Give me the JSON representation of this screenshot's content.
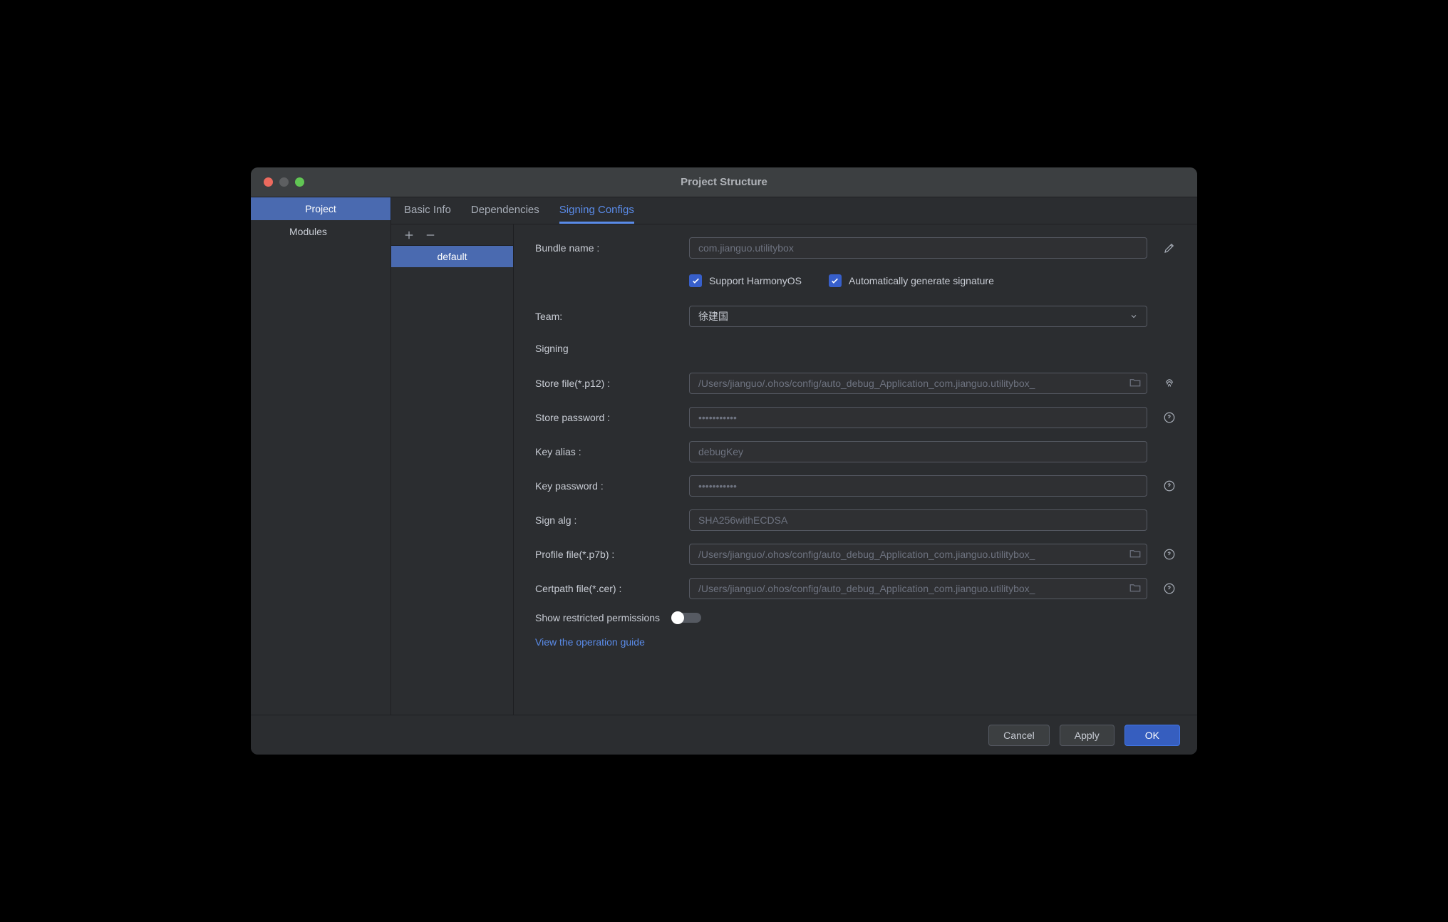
{
  "window": {
    "title": "Project Structure"
  },
  "sidebar": {
    "items": [
      {
        "label": "Project",
        "selected": true
      },
      {
        "label": "Modules",
        "selected": false
      }
    ]
  },
  "tabs": [
    {
      "label": "Basic Info",
      "active": false
    },
    {
      "label": "Dependencies",
      "active": false
    },
    {
      "label": "Signing Configs",
      "active": true
    }
  ],
  "configList": {
    "items": [
      {
        "label": "default",
        "selected": true
      }
    ]
  },
  "form": {
    "bundle_name_label": "Bundle name :",
    "bundle_name_value": "com.jianguo.utilitybox",
    "support_harmony_label": "Support HarmonyOS",
    "autogen_label": "Automatically generate signature",
    "team_label": "Team:",
    "team_value": "徐建国",
    "signing_section": "Signing",
    "store_file_label": "Store file(*.p12) :",
    "store_file_value": "/Users/jianguo/.ohos/config/auto_debug_Application_com.jianguo.utilitybox_",
    "store_pw_label": "Store password :",
    "store_pw_value": "***********",
    "key_alias_label": "Key alias :",
    "key_alias_value": "debugKey",
    "key_pw_label": "Key password :",
    "key_pw_value": "***********",
    "sign_alg_label": "Sign alg :",
    "sign_alg_value": "SHA256withECDSA",
    "profile_file_label": "Profile file(*.p7b) :",
    "profile_file_value": "/Users/jianguo/.ohos/config/auto_debug_Application_com.jianguo.utilitybox_",
    "certpath_label": "Certpath file(*.cer) :",
    "certpath_value": "/Users/jianguo/.ohos/config/auto_debug_Application_com.jianguo.utilitybox_",
    "show_restricted_label": "Show restricted permissions",
    "guide_link": "View the operation guide"
  },
  "footer": {
    "cancel": "Cancel",
    "apply": "Apply",
    "ok": "OK"
  }
}
